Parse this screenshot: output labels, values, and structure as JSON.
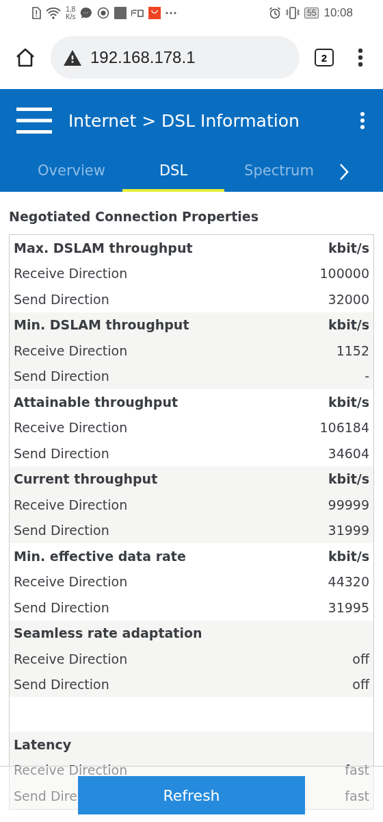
{
  "status_bar": {
    "net_speed": [
      "1,8",
      "K/s"
    ],
    "battery": "55",
    "time": "10:08"
  },
  "address_bar": {
    "url": "192.168.178.1",
    "tab_count": "2"
  },
  "header": {
    "breadcrumb": "Internet > DSL Information"
  },
  "tabs": [
    {
      "label": "Overview",
      "selected": false
    },
    {
      "label": "DSL",
      "selected": true
    },
    {
      "label": "Spectrum",
      "selected": false
    }
  ],
  "section_title": "Negotiated Connection Properties",
  "groups": [
    {
      "kind": "group",
      "title": "Max. DSLAM throughput",
      "unit": "kbit/s",
      "rows": [
        {
          "label": "Receive Direction",
          "value": "100000"
        },
        {
          "label": "Send Direction",
          "value": "32000"
        }
      ]
    },
    {
      "kind": "group",
      "title": "Min. DSLAM throughput",
      "unit": "kbit/s",
      "rows": [
        {
          "label": "Receive Direction",
          "value": "1152"
        },
        {
          "label": "Send Direction",
          "value": "-"
        }
      ]
    },
    {
      "kind": "group",
      "title": "Attainable throughput",
      "unit": "kbit/s",
      "rows": [
        {
          "label": "Receive Direction",
          "value": "106184"
        },
        {
          "label": "Send Direction",
          "value": "34604"
        }
      ]
    },
    {
      "kind": "group",
      "title": "Current throughput",
      "unit": "kbit/s",
      "rows": [
        {
          "label": "Receive Direction",
          "value": "99999"
        },
        {
          "label": "Send Direction",
          "value": "31999"
        }
      ]
    },
    {
      "kind": "group",
      "title": "Min. effective data rate",
      "unit": "kbit/s",
      "rows": [
        {
          "label": "Receive Direction",
          "value": "44320"
        },
        {
          "label": "Send Direction",
          "value": "31995"
        }
      ]
    },
    {
      "kind": "group",
      "title": "Seamless rate adaptation",
      "rows": [
        {
          "label": "Receive Direction",
          "value": "off"
        },
        {
          "label": "Send Direction",
          "value": "off"
        }
      ]
    },
    {
      "kind": "spacer"
    },
    {
      "kind": "group",
      "title": "Latency",
      "rows": [
        {
          "label": "Receive Direction",
          "value": "fast"
        },
        {
          "label": "Send Dire",
          "value": "fast"
        }
      ]
    }
  ],
  "refresh_button": "Refresh"
}
